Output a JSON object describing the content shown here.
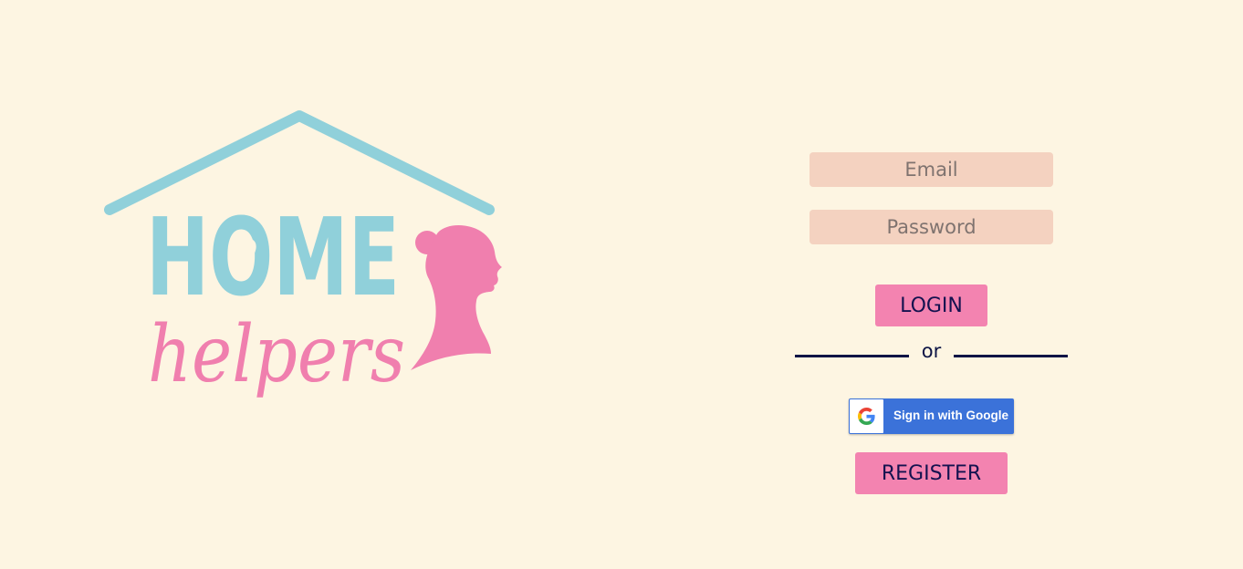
{
  "logo": {
    "line1": "HOME",
    "line2": "helpers",
    "colors": {
      "roof_and_home": "#90d0da",
      "helpers_and_silhouette": "#f07fae"
    }
  },
  "login_form": {
    "email_placeholder": "Email",
    "password_placeholder": "Password",
    "login_label": "LOGIN",
    "divider_text": "or",
    "google_label": "Sign in with Google",
    "register_label": "REGISTER"
  },
  "icons": {
    "google": "google-g-icon",
    "heart": "heart-icon"
  },
  "colors": {
    "background": "#fdf5e2",
    "input_bg": "#f4d2c0",
    "button_bg": "#f383b0",
    "text_navy": "#14124f",
    "google_blue": "#3b72d9"
  }
}
